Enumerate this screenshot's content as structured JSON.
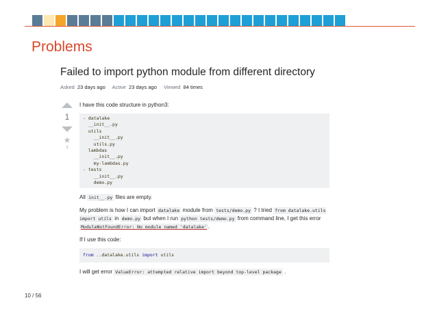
{
  "slide": {
    "nav_colors": [
      "#5b7c96",
      "#fce8b2",
      "#f4a62a",
      "#5b7c96",
      "#5b7c96",
      "#5b7c96",
      "#5b7c96",
      "#1e9fd6",
      "#1e9fd6",
      "#1e9fd6",
      "#1e9fd6",
      "#1e9fd6",
      "#1e9fd6",
      "#1e9fd6",
      "#1e9fd6",
      "#1e9fd6",
      "#1e9fd6",
      "#1e9fd6",
      "#1e9fd6",
      "#1e9fd6",
      "#1e9fd6",
      "#1e9fd6",
      "#1e9fd6",
      "#1e9fd6",
      "#1e9fd6",
      "#1e9fd6",
      "#1e9fd6"
    ],
    "rule_color": "#e0563b",
    "title": "Problems",
    "page_number": "10 / 56"
  },
  "question": {
    "title": "Failed to import python module from different directory",
    "meta": {
      "asked_label": "Asked",
      "asked_value": "23 days ago",
      "active_label": "Active",
      "active_value": "23 days ago",
      "viewed_label": "Viewed",
      "viewed_value": "84 times"
    },
    "votes": "1",
    "favorites": "1",
    "intro": "I have this code structure in python3:",
    "tree": "- datalake\n  __init__.py\n  utils\n    __init__.py\n    utils.py\n  lambdas\n    __init__.py\n    my-lambdas.py\n- tests\n    __init__.py\n    demo.py",
    "p2": {
      "a": "All",
      "code1": "init__.py",
      "b": "files are empty."
    },
    "p3": {
      "a": "My problem is how I can import",
      "code1": "datalake",
      "b": "module from",
      "code2": "tests/demo.py",
      "c": "? I tried",
      "code3": "from datalake.utils import utils",
      "d": "in",
      "code4": "demo.py",
      "e": "but when I run",
      "code5": "python tests/demo.py",
      "f": "from command line, I get this error",
      "code6": "ModuleNotFoundError: No module named 'datalake'",
      "g": "."
    },
    "p4": "If I use this code:",
    "code_block": {
      "kw1": "from",
      "mid": "..datalake.utils",
      "kw2": "import",
      "end": "utils"
    },
    "p5": {
      "a": "I will get error",
      "code1": "ValueError: attempted relative import beyond top-level package",
      "b": "."
    }
  }
}
